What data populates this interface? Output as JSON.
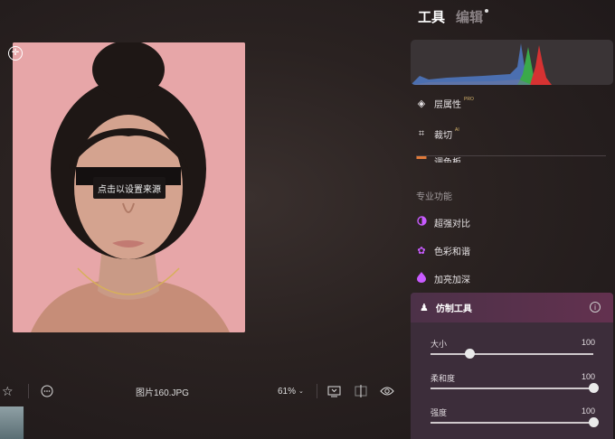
{
  "tooltip": "点击以设置来源",
  "bottom_bar": {
    "file_name": "图片160.JPG",
    "zoom": "61%"
  },
  "panel": {
    "tabs": [
      {
        "label": "工具",
        "active": true
      },
      {
        "label": "编辑",
        "active": false
      }
    ],
    "tools": [
      {
        "label": "层属性",
        "badge": "PRO",
        "icon": "layers-icon"
      },
      {
        "label": "裁切",
        "badge": "AI",
        "icon": "crop-icon"
      },
      {
        "label": "调色板",
        "icon": "palette-icon"
      }
    ],
    "section_title": "专业功能",
    "pro_tools": [
      {
        "label": "超强对比",
        "icon": "contrast-icon"
      },
      {
        "label": "色彩和谐",
        "icon": "color-harmony-icon"
      },
      {
        "label": "加亮加深",
        "icon": "dodge-burn-icon"
      }
    ],
    "clone_tool": {
      "title": "仿制工具",
      "sliders": [
        {
          "label": "大小",
          "value": "100",
          "level": 0.24
        },
        {
          "label": "柔和度",
          "value": "100",
          "level": 1.0
        },
        {
          "label": "强度",
          "value": "100",
          "level": 1.0
        }
      ]
    }
  },
  "colors": {
    "accent": "#c85bff",
    "clone_header": "#63314f",
    "histogram_blue": "#4b6fb0",
    "histogram_green": "#3aa94a",
    "histogram_red": "#d63232"
  }
}
